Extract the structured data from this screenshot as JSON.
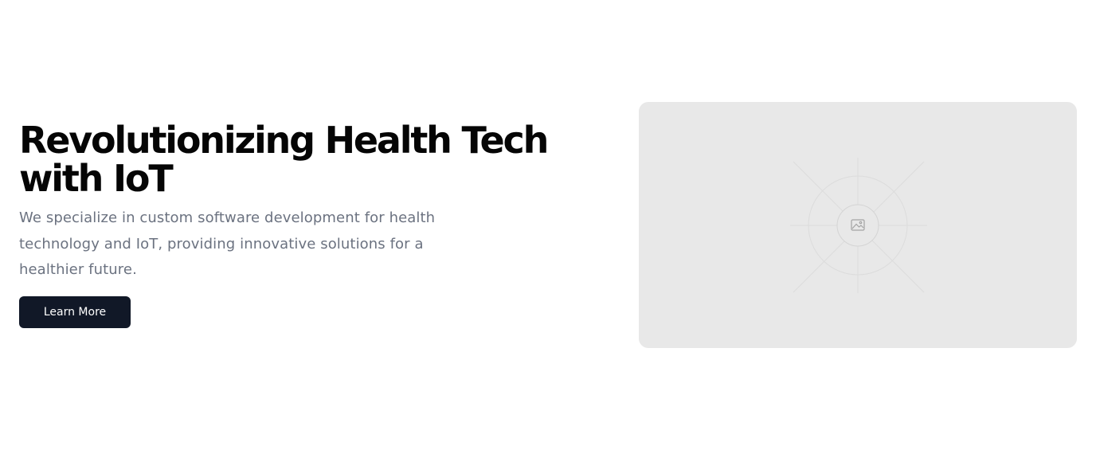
{
  "hero": {
    "title": "Revolutionizing Health Tech with IoT",
    "description": "We specialize in custom software development for health technology and IoT, providing innovative solutions for a healthier future.",
    "cta_label": "Learn More"
  },
  "media": {
    "icon": "image-placeholder-icon"
  },
  "colors": {
    "background": "#ffffff",
    "heading": "#050505",
    "body_text": "#6b7280",
    "button_bg": "#111827",
    "button_text": "#ffffff",
    "placeholder_bg": "#e8e8e8"
  }
}
